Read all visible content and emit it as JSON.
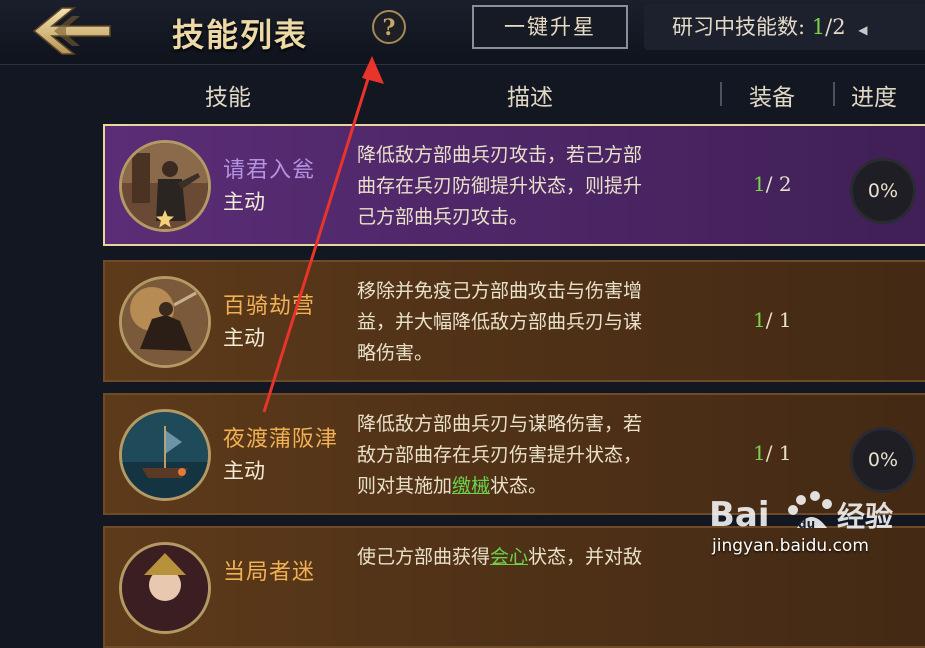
{
  "header": {
    "title": "技能列表",
    "help": "?",
    "onekey_label": "一键升星",
    "study_label": "研习中技能数:",
    "study_current": "1",
    "study_total": "/2"
  },
  "columns": {
    "skill": "技能",
    "desc": "描述",
    "equip": "装备",
    "progress": "进度"
  },
  "skills": [
    {
      "name": "请君入瓮",
      "type": "主动",
      "desc": [
        "降低敌方部曲兵刃攻击，若己方部",
        "曲存在兵刃防御提升状态，则提升",
        "己方部曲兵刃攻击。"
      ],
      "equip_cur": "1",
      "equip_total": "/ 2",
      "progress": "0%"
    },
    {
      "name": "百骑劫营",
      "type": "主动",
      "desc": [
        "移除并免疫己方部曲攻击与伤害增",
        "益，并大幅降低敌方部曲兵刃与谋",
        "略伤害。"
      ],
      "equip_cur": "1",
      "equip_total": "/ 1"
    },
    {
      "name": "夜渡蒲阪津",
      "type": "主动",
      "desc": [
        "降低敌方部曲兵刃与谋略伤害，若",
        "敌方部曲存在兵刃伤害提升状态，"
      ],
      "desc3_pre": "则对其施加",
      "desc3_kw": "缴械",
      "desc3_post": "状态。",
      "equip_cur": "1",
      "equip_total": "/ 1",
      "progress": "0%"
    },
    {
      "name": "当局者迷",
      "desc_pre": "使己方部曲获得",
      "desc_kw": "会心",
      "desc_post": "状态，并对敌"
    }
  ],
  "watermark": {
    "brand": "Bai",
    "brand_du": "du",
    "brand_cn": "经验",
    "url": "jingyan.baidu.com"
  }
}
